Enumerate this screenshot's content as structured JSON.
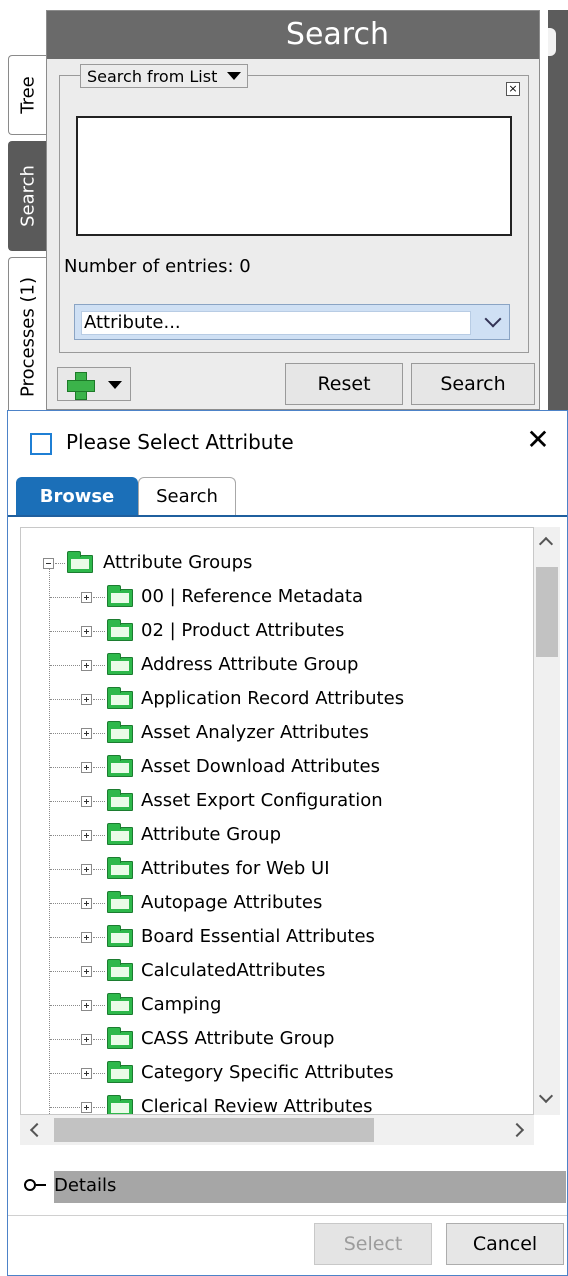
{
  "search_panel": {
    "title": "Search",
    "side_tabs": [
      {
        "label": "Tree",
        "active": false
      },
      {
        "label": "Search",
        "active": true
      },
      {
        "label": "Processes (1)",
        "active": false
      }
    ],
    "list_mode_label": "Search from List",
    "entries_label": "Number of entries: 0",
    "attribute_placeholder": "Attribute...",
    "reset_label": "Reset",
    "search_label": "Search"
  },
  "dialog": {
    "title": "Please Select Attribute",
    "tabs": [
      {
        "label": "Browse",
        "active": true
      },
      {
        "label": "Search",
        "active": false
      }
    ],
    "tree": {
      "root": "Attribute Groups",
      "children": [
        "00 | Reference Metadata",
        "02 | Product Attributes",
        "Address Attribute Group",
        "Application Record Attributes",
        "Asset Analyzer Attributes",
        "Asset Download Attributes",
        "Asset Export Configuration",
        "Attribute Group",
        "Attributes for Web UI",
        "Autopage Attributes",
        "Board Essential Attributes",
        "CalculatedAttributes",
        "Camping",
        "CASS Attribute Group",
        "Category Specific Attributes",
        "Clerical Review Attributes"
      ]
    },
    "details_label": "Details",
    "select_label": "Select",
    "cancel_label": "Cancel"
  },
  "colors": {
    "panel_header": "#6a6a6a",
    "browse_tab": "#1b6fb8",
    "folder_green": "#2eb84b",
    "dialog_border": "#4d83c8"
  }
}
